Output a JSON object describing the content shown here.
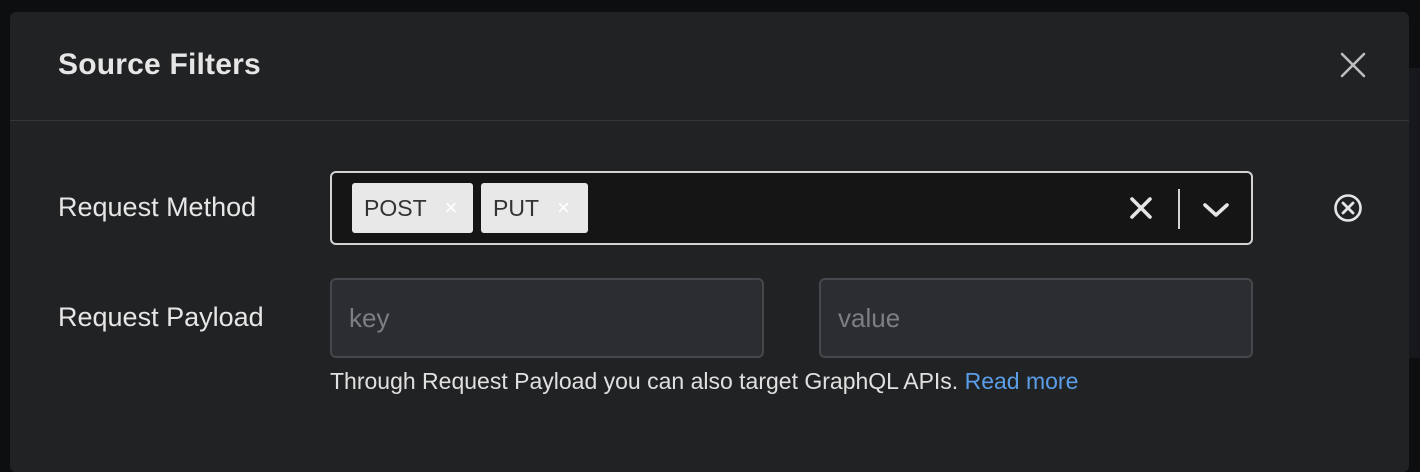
{
  "modal": {
    "title": "Source Filters"
  },
  "request_method": {
    "label": "Request Method",
    "selected": [
      "POST",
      "PUT"
    ],
    "tag_remove_glyph": "×"
  },
  "request_payload": {
    "label": "Request Payload",
    "key_placeholder": "key",
    "value_placeholder": "value",
    "helper_text": "Through Request Payload you can also target GraphQL APIs.",
    "helper_link": "Read more"
  },
  "colors": {
    "link": "#5b9ee8",
    "modal_bg": "#212224",
    "tag_bg": "#e8e8e8"
  },
  "icons": {
    "close": "close-icon",
    "clear": "clear-icon",
    "dropdown": "chevron-down-icon",
    "remove_row": "circle-x-icon"
  }
}
